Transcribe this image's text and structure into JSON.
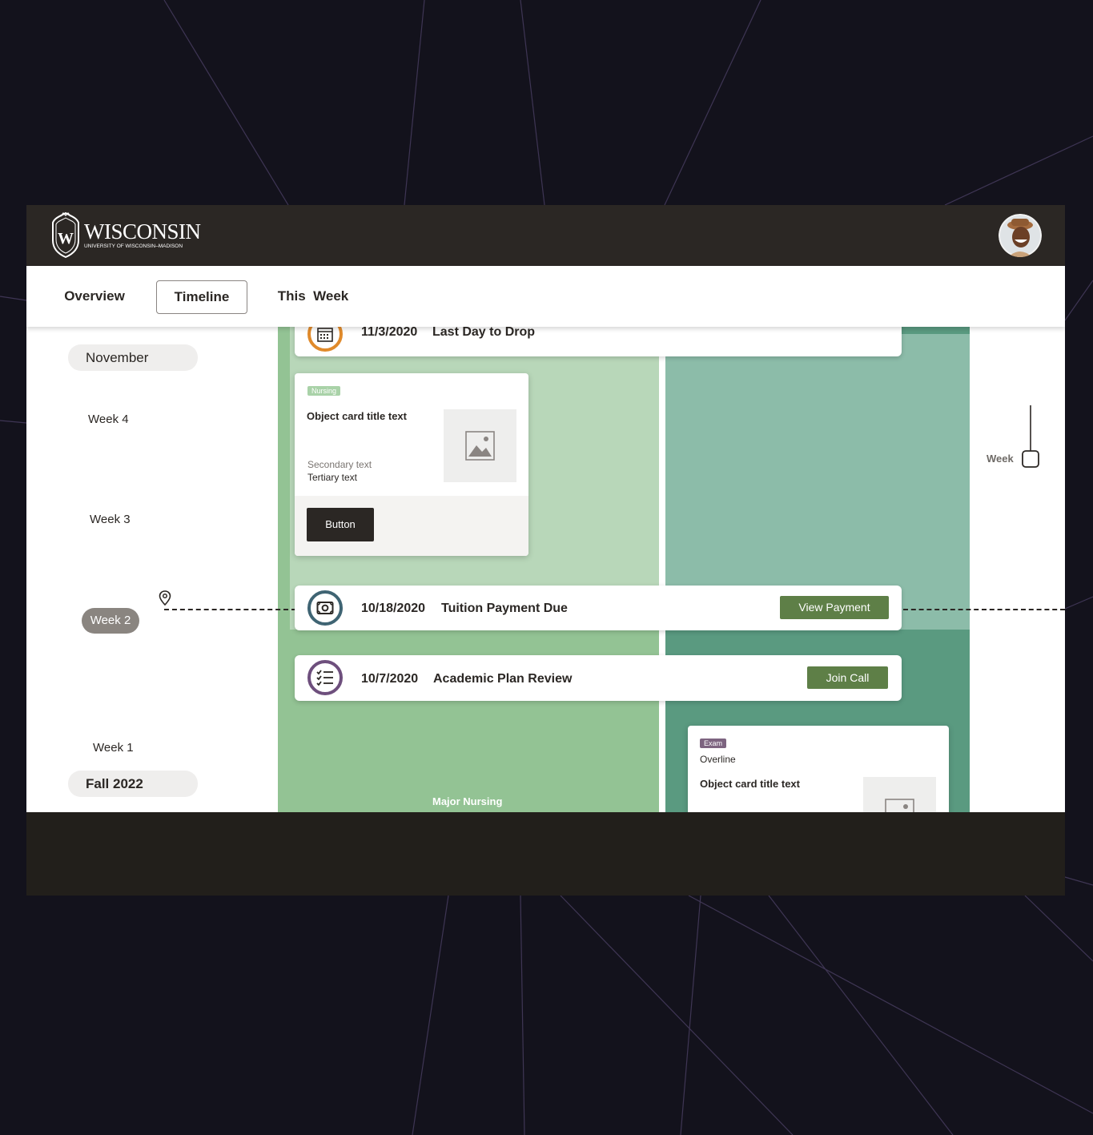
{
  "header": {
    "logo_word": "WISCONSIN",
    "logo_sub": "UNIVERSITY OF WISCONSIN–MADISON"
  },
  "tabs": [
    {
      "label": "Overview"
    },
    {
      "label": "Timeline",
      "selected": true
    },
    {
      "label": "This  Week"
    }
  ],
  "left_timeline": {
    "month": "November",
    "weeks": [
      "Week 4",
      "Week 3",
      "Week 2",
      "Week 1"
    ],
    "current_week": "Week 2",
    "term": "Fall 2022"
  },
  "events": [
    {
      "date": "11/3/2020",
      "title": "Last Day to Drop",
      "icon": "calendar-icon",
      "ring_color": "#e08a2b"
    },
    {
      "date": "10/18/2020",
      "title": "Tuition Payment Due",
      "icon": "money-icon",
      "ring_color": "#3f6473",
      "button": "View Payment"
    },
    {
      "date": "10/7/2020",
      "title": "Academic Plan Review",
      "icon": "checklist-icon",
      "ring_color": "#6e4f7d",
      "button": "Join Call"
    }
  ],
  "object_card": {
    "tag": "Nursing",
    "title": "Object card title text",
    "secondary": "Secondary text",
    "tertiary": "Tertiary text",
    "button": "Button"
  },
  "exam_card": {
    "tag": "Exam",
    "overline": "Overline",
    "title": "Object card title text"
  },
  "lane_label": "Major Nursing",
  "zoom_slider": {
    "label": "Week"
  },
  "colors": {
    "topbar": "#2b2724",
    "lane_light": "#b8d7b9",
    "lane_mid": "#93c394",
    "lane_teal": "#8cbca9",
    "lane_teal_dark": "#5a9a80",
    "button_green": "#5e7f47",
    "tag_nursing": "#a9d2a8",
    "tag_exam": "#7d6480"
  }
}
